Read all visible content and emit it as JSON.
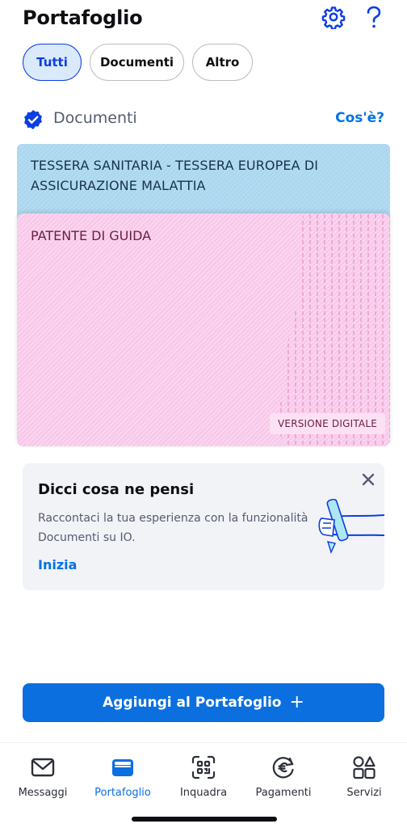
{
  "header": {
    "title": "Portafoglio"
  },
  "filters": [
    {
      "label": "Tutti",
      "active": true
    },
    {
      "label": "Documenti",
      "active": false
    },
    {
      "label": "Altro",
      "active": false
    }
  ],
  "section": {
    "title": "Documenti",
    "link": "Cos'è?"
  },
  "cards": {
    "health": {
      "title": "TESSERA SANITARIA - TESSERA EUROPEA DI ASSICURAZIONE MALATTIA"
    },
    "licence": {
      "title": "PATENTE DI GUIDA",
      "tag": "VERSIONE DIGITALE"
    }
  },
  "feedback": {
    "title": "Dicci cosa ne pensi",
    "body": "Raccontaci la tua esperienza con la funzionalità Documenti su IO.",
    "cta": "Inizia"
  },
  "add_button": {
    "label": "Aggiungi al Portafoglio",
    "icon": "+"
  },
  "tabs": [
    {
      "label": "Messaggi",
      "icon": "mail-icon",
      "active": false
    },
    {
      "label": "Portafoglio",
      "icon": "wallet-icon",
      "active": true
    },
    {
      "label": "Inquadra",
      "icon": "qr-scan-icon",
      "active": false
    },
    {
      "label": "Pagamenti",
      "icon": "euro-icon",
      "active": false
    },
    {
      "label": "Servizi",
      "icon": "services-icon",
      "active": false
    }
  ],
  "colors": {
    "accent": "#0b6fe0",
    "link": "#0073e6",
    "health_card": "#b5dcf1",
    "licence_card": "#fbd6ef"
  }
}
